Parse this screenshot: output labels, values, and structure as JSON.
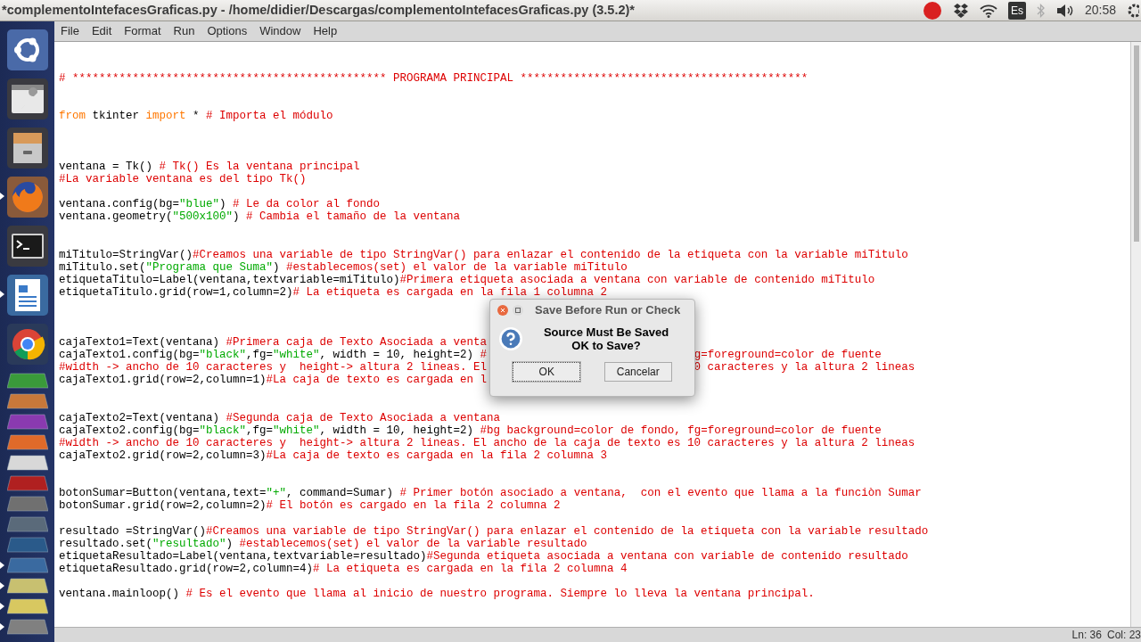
{
  "top_bar": {
    "window_title": "*complementoIntefacesGraficas.py - /home/didier/Descargas/complementoIntefacesGraficas.py (3.5.2)*",
    "keyboard_layout": "Es",
    "time": "20:58"
  },
  "launcher": [
    {
      "running": false
    },
    {
      "running": false
    },
    {
      "running": false
    },
    {
      "running": true
    },
    {
      "running": false
    },
    {
      "running": true
    },
    {
      "running": false
    },
    {
      "running": false
    },
    {
      "running": false
    },
    {
      "running": false
    },
    {
      "running": false
    },
    {
      "running": false
    },
    {
      "running": false
    },
    {
      "running": false
    },
    {
      "running": false
    },
    {
      "running": false
    },
    {
      "running": true
    },
    {
      "running": true
    },
    {
      "running": true
    },
    {
      "running": true
    }
  ],
  "menu": [
    "File",
    "Edit",
    "Format",
    "Run",
    "Options",
    "Window",
    "Help"
  ],
  "editor": {
    "blocks": [
      [
        {
          "parts": [
            {
              "kind": "comment",
              "text": "# *********************************************** PROGRAMA PRINCIPAL *******************************************"
            }
          ]
        }
      ],
      [
        {
          "parts": [
            {
              "kind": "keyword",
              "text": "from"
            },
            {
              "kind": "code",
              "text": " tkinter "
            },
            {
              "kind": "keyword",
              "text": "import"
            },
            {
              "kind": "code",
              "text": " * "
            },
            {
              "kind": "comment",
              "text": "# Importa el módulo"
            }
          ]
        }
      ],
      [
        {
          "parts": [
            {
              "kind": "code",
              "text": "ventana = Tk() "
            },
            {
              "kind": "comment",
              "text": "# Tk() Es la ventana principal"
            }
          ]
        },
        {
          "parts": [
            {
              "kind": "comment",
              "text": "#La variable ventana es del tipo Tk()"
            }
          ]
        }
      ],
      [
        {
          "parts": [
            {
              "kind": "code",
              "text": "ventana.config(bg="
            },
            {
              "kind": "string",
              "text": "\"blue\""
            },
            {
              "kind": "code",
              "text": ") "
            },
            {
              "kind": "comment",
              "text": "# Le da color al fondo"
            }
          ]
        },
        {
          "parts": [
            {
              "kind": "code",
              "text": "ventana.geometry("
            },
            {
              "kind": "string",
              "text": "\"500x100\""
            },
            {
              "kind": "code",
              "text": ") "
            },
            {
              "kind": "comment",
              "text": "# Cambia el tamaño de la ventana"
            }
          ]
        }
      ],
      [
        {
          "parts": [
            {
              "kind": "code",
              "text": "miTitulo=StringVar()"
            },
            {
              "kind": "comment",
              "text": "#Creamos una variable de tipo StringVar() para enlazar el contenido de la etiqueta con la variable miTitulo"
            }
          ]
        },
        {
          "parts": [
            {
              "kind": "code",
              "text": "miTitulo.set("
            },
            {
              "kind": "string",
              "text": "\"Programa que Suma\""
            },
            {
              "kind": "code",
              "text": ") "
            },
            {
              "kind": "comment",
              "text": "#establecemos(set) el valor de la variable miTitulo"
            }
          ]
        },
        {
          "parts": [
            {
              "kind": "code",
              "text": "etiquetaTitulo=Label(ventana,textvariable=miTitulo)"
            },
            {
              "kind": "comment",
              "text": "#Primera etiqueta asociada a ventana con variable de contenido miTitulo"
            }
          ]
        },
        {
          "parts": [
            {
              "kind": "code",
              "text": "etiquetaTitulo.grid(row=1,column=2)"
            },
            {
              "kind": "comment",
              "text": "# La etiqueta es cargada en la fila 1 columna 2"
            }
          ]
        }
      ],
      [
        {
          "parts": [
            {
              "kind": "code",
              "text": "cajaTexto1=Text(ventana) "
            },
            {
              "kind": "comment",
              "text": "#Primera caja de Texto Asociada a venta"
            }
          ]
        },
        {
          "parts": [
            {
              "kind": "code",
              "text": "cajaTexto1.config(bg="
            },
            {
              "kind": "string",
              "text": "\"black\""
            },
            {
              "kind": "code",
              "text": ",fg="
            },
            {
              "kind": "string",
              "text": "\"white\""
            },
            {
              "kind": "code",
              "text": ", width = 10, height=2) "
            },
            {
              "kind": "comment",
              "text": "#"
            }
          ],
          "right": [
            {
              "kind": "comment",
              "text": "g=foreground=color de fuente"
            }
          ]
        },
        {
          "parts": [
            {
              "kind": "comment",
              "text": "#width -> ancho de 10 caracteres y  height-> altura 2 lineas. El"
            }
          ],
          "right": [
            {
              "kind": "comment",
              "text": "0 caracteres y la altura 2 lineas"
            }
          ]
        },
        {
          "parts": [
            {
              "kind": "code",
              "text": "cajaTexto1.grid(row=2,column=1)"
            },
            {
              "kind": "comment",
              "text": "#La caja de texto es cargada en l"
            }
          ]
        }
      ],
      [
        {
          "parts": [
            {
              "kind": "code",
              "text": "cajaTexto2=Text(ventana) "
            },
            {
              "kind": "comment",
              "text": "#Segunda caja de Texto Asociada a ventana"
            }
          ]
        },
        {
          "parts": [
            {
              "kind": "code",
              "text": "cajaTexto2.config(bg="
            },
            {
              "kind": "string",
              "text": "\"black\""
            },
            {
              "kind": "code",
              "text": ",fg="
            },
            {
              "kind": "string",
              "text": "\"white\""
            },
            {
              "kind": "code",
              "text": ", width = 10, height=2) "
            },
            {
              "kind": "comment",
              "text": "#bg background=color de fondo, fg=foreground=color de fuente"
            }
          ]
        },
        {
          "parts": [
            {
              "kind": "comment",
              "text": "#width -> ancho de 10 caracteres y  height-> altura 2 lineas. El ancho de la caja de texto es 10 caracteres y la altura 2 lineas"
            }
          ]
        },
        {
          "parts": [
            {
              "kind": "code",
              "text": "cajaTexto2.grid(row=2,column=3)"
            },
            {
              "kind": "comment",
              "text": "#La caja de texto es cargada en la fila 2 columna 3"
            }
          ]
        }
      ],
      [
        {
          "parts": [
            {
              "kind": "code",
              "text": "botonSumar=Button(ventana,text="
            },
            {
              "kind": "string",
              "text": "\"+\""
            },
            {
              "kind": "code",
              "text": ", command=Sumar) "
            },
            {
              "kind": "comment",
              "text": "# Primer botón asociado a ventana,  con el evento que llama a la funciòn Sumar"
            }
          ]
        },
        {
          "parts": [
            {
              "kind": "code",
              "text": "botonSumar.grid(row=2,column=2)"
            },
            {
              "kind": "comment",
              "text": "# El botón es cargado en la fila 2 columna 2"
            }
          ]
        }
      ],
      [
        {
          "parts": [
            {
              "kind": "code",
              "text": "resultado =StringVar()"
            },
            {
              "kind": "comment",
              "text": "#Creamos una variable de tipo StringVar() para enlazar el contenido de la etiqueta con la variable resultado"
            }
          ]
        },
        {
          "parts": [
            {
              "kind": "code",
              "text": "resultado.set("
            },
            {
              "kind": "string",
              "text": "\"resultado\""
            },
            {
              "kind": "code",
              "text": ") "
            },
            {
              "kind": "comment",
              "text": "#establecemos(set) el valor de la variable resultado"
            }
          ]
        },
        {
          "parts": [
            {
              "kind": "code",
              "text": "etiquetaResultado=Label(ventana,textvariable=resultado)"
            },
            {
              "kind": "comment",
              "text": "#Segunda etiqueta asociada a ventana con variable de contenido resultado"
            }
          ]
        },
        {
          "parts": [
            {
              "kind": "code",
              "text": "etiquetaResultado.grid(row=2,column=4)"
            },
            {
              "kind": "comment",
              "text": "# La etiqueta es cargada en la fila 2 columna 4"
            }
          ]
        }
      ],
      [
        {
          "parts": [
            {
              "kind": "code",
              "text": "ventana.mainloop() "
            },
            {
              "kind": "comment",
              "text": "# Es el evento que llama al inicio de nuestro programa. Siempre lo lleva la ventana principal."
            }
          ]
        }
      ]
    ]
  },
  "dialog": {
    "title": "Save Before Run or Check",
    "message": [
      "Source Must Be Saved",
      "OK to Save?"
    ],
    "buttons": [
      {
        "label": "OK",
        "focused": true
      },
      {
        "label": "Cancelar",
        "focused": false
      }
    ]
  },
  "status_bar": {
    "line": "Ln: 36",
    "column": "Col: 23"
  }
}
